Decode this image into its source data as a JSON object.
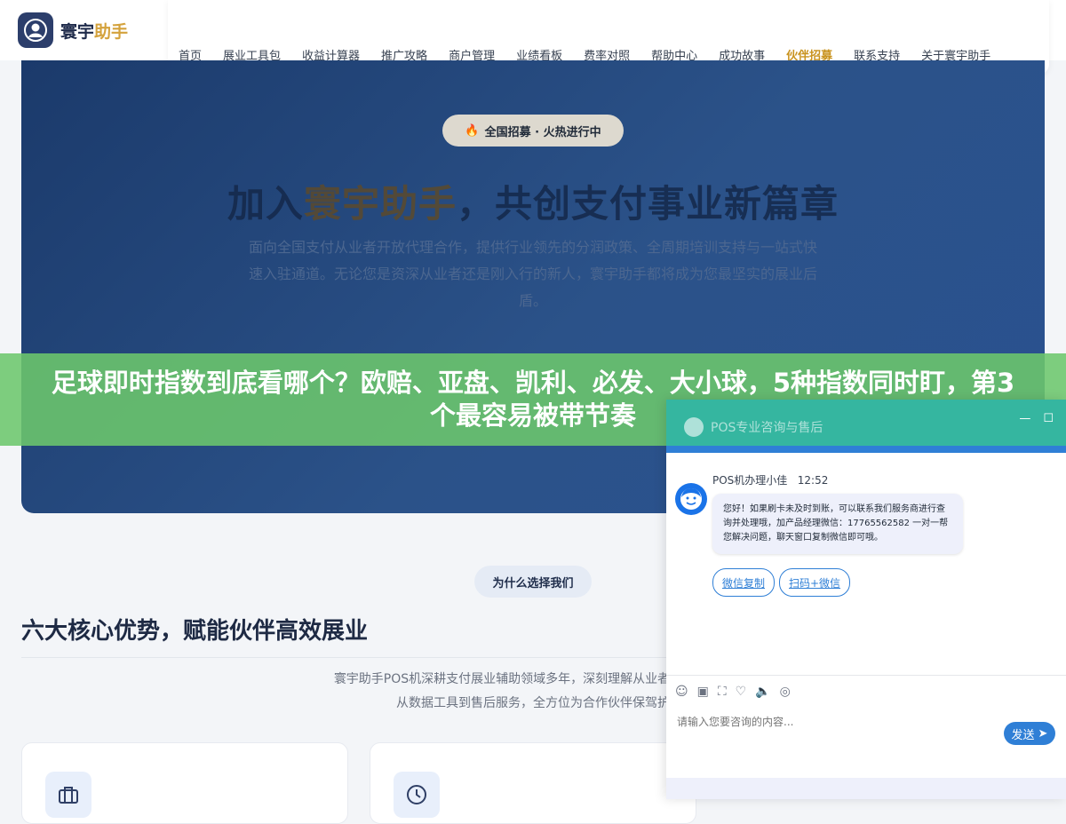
{
  "header": {
    "logo_text_main": "寰宇",
    "logo_text_accent": "助手",
    "nav": [
      "首页",
      "展业工具包",
      "收益计算器",
      "推广攻略",
      "商户管理",
      "业绩看板",
      "费率对照",
      "帮助中心",
      "成功故事",
      "伙伴招募",
      "联系支持",
      "关于寰宇助手"
    ],
    "nav_highlight": "伙伴招募"
  },
  "hero": {
    "badge": "全国招募 · 火热进行中",
    "badge_icon": "flame-icon",
    "title_pre": "加入",
    "title_gold": "寰宇助手",
    "title_post": "，共创支付事业新篇章",
    "desc": "面向全国支付从业者开放代理合作，提供行业领先的分润政策、全周期培训支持与一站式快速入驻通道。无论您是资深从业者还是刚入行的新人，寰宇助手都将成为您最坚实的展业后盾。"
  },
  "banner": {
    "text": "足球即时指数到底看哪个？欧赔、亚盘、凯利、必发、大小球，5种指数同时盯，第3个最容易被带节奏"
  },
  "section": {
    "pill": "为什么选择我们",
    "title": "六大核心优势，赋能伙伴高效展业",
    "desc_line1": "寰宇助手POS机深耕支付展业辅助领域多年，深刻理解从业者痛点与需求",
    "desc_line2": "从数据工具到售后服务，全方位为合作伙伴保驾护"
  },
  "chat": {
    "title": "POS专业咨询与售后",
    "sender": "POS机办理小佳",
    "time": "12:52",
    "message": "您好！如果刷卡未及时到账，可以联系我们服务商进行查询并处理哦，加产品经理微信：17765562582 一对一帮您解决问题，聊天窗口复制微信即可哦。",
    "quick_replies": [
      "微信复制",
      "扫码+微信"
    ],
    "input_placeholder": "请输入您要咨询的内容...",
    "send_label": "发送",
    "toolbar_icons": [
      "emoji-icon",
      "image-icon",
      "screenshot-icon",
      "rate-icon",
      "sound-icon",
      "wechat-icon"
    ]
  },
  "colors": {
    "brand_dark": "#2c3e6b",
    "accent_gold": "#d4a23c",
    "chat_teal": "#35b6a0",
    "chat_blue": "#2f7fd6",
    "banner_green": "#6cc76c"
  }
}
